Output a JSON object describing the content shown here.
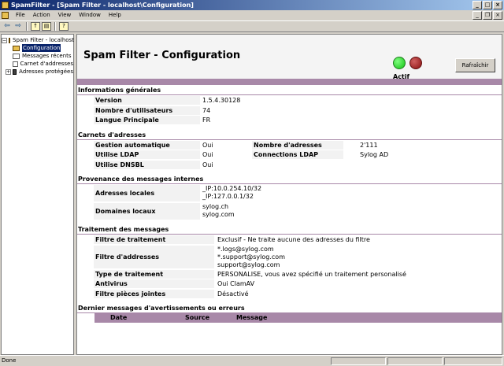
{
  "window": {
    "title": "SpamFilter - [Spam Filter - localhost\\Configuration]"
  },
  "menu": [
    "File",
    "Action",
    "View",
    "Window",
    "Help"
  ],
  "tree": {
    "root": "Spam Filter - localhost",
    "items": [
      "Configuration",
      "Messages récents",
      "Carnet d'addresses",
      "Adresses protégées"
    ]
  },
  "header": {
    "title": "Spam Filter - Configuration",
    "status": "Actif",
    "refresh": "Rafraîchir"
  },
  "general": {
    "title": "Informations générales",
    "version_label": "Version",
    "version": "1.5.4.30128",
    "users_label": "Nombre d'utilisateurs",
    "users": "74",
    "lang_label": "Langue Principale",
    "lang": "FR"
  },
  "address_book": {
    "title": "Carnets d'adresses",
    "auto_label": "Gestion automatique",
    "auto": "Oui",
    "ldap_label": "Utilise LDAP",
    "ldap": "Oui",
    "dnsbl_label": "Utilise DNSBL",
    "dnsbl": "Oui",
    "count_label": "Nombre d'adresses",
    "count": "2'111",
    "conn_label": "Connections LDAP",
    "conn": "Sylog AD"
  },
  "internal": {
    "title": "Provenance des messages internes",
    "local_label": "Adresses locales",
    "local": [
      "_IP:10.0.254.10/32",
      "_IP:127.0.0.1/32"
    ],
    "domains_label": "Domaines locaux",
    "domains": [
      "sylog.ch",
      "sylog.com"
    ]
  },
  "processing": {
    "title": "Traitement des messages",
    "filter_label": "Filtre de traitement",
    "filter": "Exclusif - Ne traite aucune des adresses du filtre",
    "addr_label": "Filtre d'addresses",
    "addresses": [
      "*.logs@sylog.com",
      "*.support@sylog.com",
      "support@sylog.com"
    ],
    "type_label": "Type de traitement",
    "type": "PERSONALISE, vous avez spécifié un traitement personalisé",
    "av_label": "Antivirus",
    "av": "Oui ClamAV",
    "attach_label": "Filtre pièces jointes",
    "attach": "Désactivé"
  },
  "messages": {
    "title": "Dernier messages d'avertissements ou erreurs",
    "cols": [
      "Date",
      "Source",
      "Message"
    ]
  },
  "statusbar": {
    "text": "Done"
  },
  "colors": {
    "accent_bar": "#a888a8",
    "title_bar": "#0a246a",
    "active": "#10c010",
    "inactive": "#8a1010"
  }
}
